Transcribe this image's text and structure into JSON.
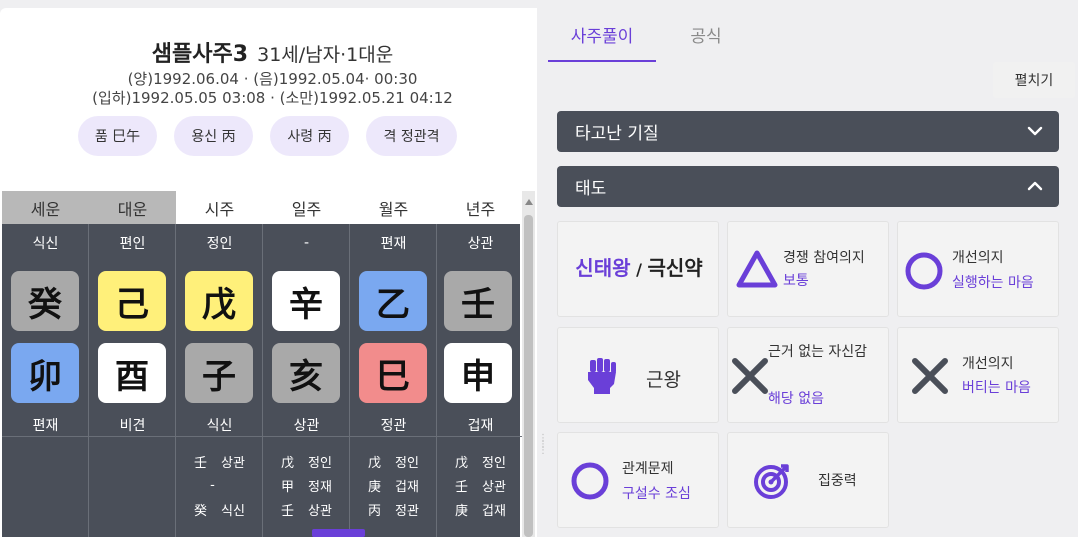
{
  "profile": {
    "name": "샘플사주3",
    "summary": "31세/남자·1대운",
    "date_line1": "(양)1992.06.04 · (음)1992.05.04· 00:30",
    "date_line2": "(입하)1992.05.05 03:08 · (소만)1992.05.21 04:12",
    "tags": [
      "품 巳午",
      "용신 丙",
      "사령 丙",
      "격 정관격"
    ]
  },
  "table": {
    "headers": [
      "세운",
      "대운",
      "시주",
      "일주",
      "월주",
      "년주"
    ],
    "top_labels": [
      "식신",
      "편인",
      "정인",
      "-",
      "편재",
      "상관"
    ],
    "stems": [
      {
        "char": "癸",
        "color": "gray"
      },
      {
        "char": "己",
        "color": "yellow"
      },
      {
        "char": "戊",
        "color": "yellow"
      },
      {
        "char": "辛",
        "color": "white"
      },
      {
        "char": "乙",
        "color": "blue"
      },
      {
        "char": "壬",
        "color": "gray"
      }
    ],
    "branches": [
      {
        "char": "卯",
        "color": "blue"
      },
      {
        "char": "酉",
        "color": "white"
      },
      {
        "char": "子",
        "color": "gray"
      },
      {
        "char": "亥",
        "color": "gray"
      },
      {
        "char": "巳",
        "color": "red"
      },
      {
        "char": "申",
        "color": "white"
      }
    ],
    "bottom_labels": [
      "편재",
      "비견",
      "식신",
      "상관",
      "정관",
      "겁재"
    ],
    "hidden": [
      [],
      [],
      [
        [
          "壬",
          "상관"
        ],
        [
          "-",
          ""
        ],
        [
          "癸",
          "식신"
        ]
      ],
      [
        [
          "戊",
          "정인"
        ],
        [
          "甲",
          "정재"
        ],
        [
          "壬",
          "상관"
        ]
      ],
      [
        [
          "戊",
          "정인"
        ],
        [
          "庚",
          "겁재"
        ],
        [
          "丙",
          "정관"
        ]
      ],
      [
        [
          "戊",
          "정인"
        ],
        [
          "壬",
          "상관"
        ],
        [
          "庚",
          "겁재"
        ]
      ]
    ]
  },
  "tabs": [
    "사주풀이",
    "공식"
  ],
  "expand_label": "펼치기",
  "sections": [
    "타고난 기질",
    "태도"
  ],
  "cards": {
    "strength_primary": "신태왕",
    "strength_sep": " / ",
    "strength_secondary": "극신약",
    "competition_label": "경쟁 참여의지",
    "competition_value": "보통",
    "improve1_label": "개선의지",
    "improve1_value": "실행하는 마음",
    "root_label": "근왕",
    "confidence_label": "근거 없는 자신감",
    "confidence_value": "해당 없음",
    "improve2_label": "개선의지",
    "improve2_value": "버티는 마음",
    "relation_label": "관계문제",
    "relation_value": "구설수 조심",
    "focus_label": "집중력"
  },
  "colors": {
    "accent": "#6a3fd8",
    "section_bg": "#4a4f59",
    "pill_bg": "#ede8fb"
  }
}
